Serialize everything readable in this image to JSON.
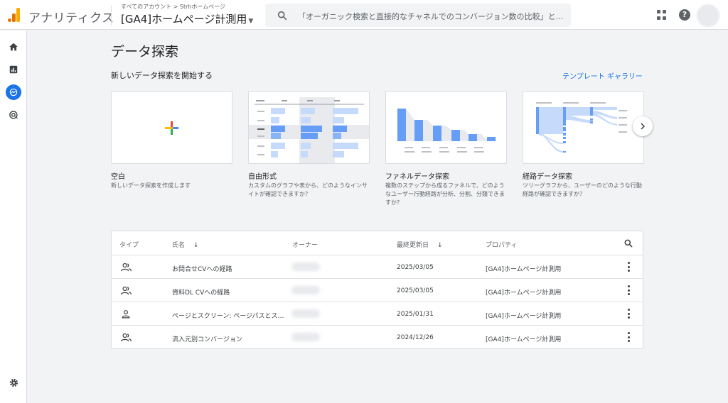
{
  "app": {
    "title": "アナリティクス"
  },
  "account": {
    "breadcrumb": "すべてのアカウント > Strhホームページ",
    "property": "[GA4]ホームページ計測用"
  },
  "search": {
    "placeholder": "「オーガニック検索と直接的なチャネルでのコンバージョン数の比較」と検索"
  },
  "nav": {
    "icons": [
      "home-icon",
      "reports-icon",
      "explore-icon",
      "advertising-icon",
      "settings-icon"
    ],
    "active": "explore-icon"
  },
  "main": {
    "title": "データ探索",
    "section": "新しいデータ探索を開始する",
    "gallery_link": "テンプレート ギャラリー",
    "templates": [
      {
        "title": "空白",
        "desc": "新しいデータ探索を作成します"
      },
      {
        "title": "自由形式",
        "desc": "カスタムのグラフや表から、どのようなインサイトが確認できますか？"
      },
      {
        "title": "ファネルデータ探索",
        "desc": "複数のステップから成るファネルで、どのようなユーザー行動経路が分析、分割、分類できますか？"
      },
      {
        "title": "経路データ探索",
        "desc": "ツリーグラフから、ユーザーのどのような行動経路が確認できますか？"
      }
    ]
  },
  "table": {
    "headers": {
      "type": "タイプ",
      "name": "氏名",
      "owner": "オーナー",
      "updated": "最終更新日",
      "property": "プロパティ"
    },
    "rows": [
      {
        "type_icon": "shared-users-icon",
        "name": "お問合せCVへの経路",
        "updated": "2025/03/05",
        "property": "[GA4]ホームページ計測用"
      },
      {
        "type_icon": "shared-users-icon",
        "name": "資料DL CVへの経路",
        "updated": "2025/03/05",
        "property": "[GA4]ホームページ計測用"
      },
      {
        "type_icon": "single-user-icon",
        "name": "ページとスクリーン: ページパスとス…",
        "updated": "2025/01/31",
        "property": "[GA4]ホームページ計測用"
      },
      {
        "type_icon": "shared-users-icon",
        "name": "流入元別コンバージョン",
        "updated": "2024/12/26",
        "property": "[GA4]ホームページ計測用"
      }
    ]
  },
  "colors": {
    "accent": "#1a73e8",
    "chart_light": "#c6dafc",
    "chart_mid": "#8ab4f8",
    "chart_dark": "#669df6"
  }
}
